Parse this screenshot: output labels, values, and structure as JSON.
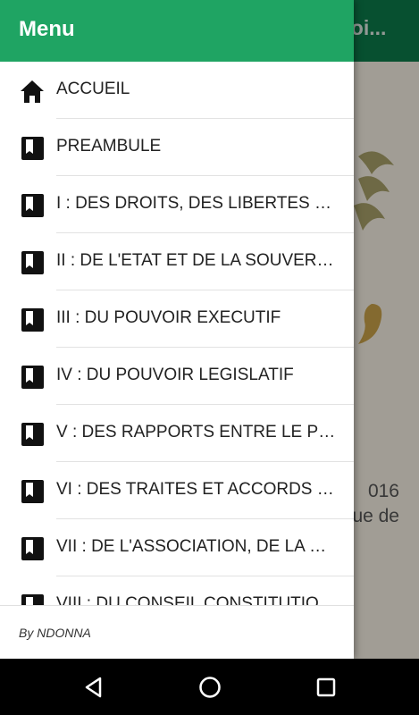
{
  "background": {
    "title": "voi...",
    "text_line1": "016",
    "text_line2": "ue de"
  },
  "drawer": {
    "title": "Menu",
    "items": [
      {
        "label": "ACCUEIL",
        "icon": "home-icon"
      },
      {
        "label": "PREAMBULE",
        "icon": "book-icon"
      },
      {
        "label": "I : DES DROITS, DES LIBERTES ET DES DEVOIRS",
        "icon": "book-icon"
      },
      {
        "label": "II : DE L'ETAT ET DE LA SOUVERAINETE",
        "icon": "book-icon"
      },
      {
        "label": "III : DU POUVOIR EXECUTIF",
        "icon": "book-icon"
      },
      {
        "label": "IV : DU POUVOIR LEGISLATIF",
        "icon": "book-icon"
      },
      {
        "label": "V : DES RAPPORTS ENTRE LE POUVOIR EXECUTIF ET LE POUVOIR LEGISLATIF",
        "icon": "book-icon"
      },
      {
        "label": "VI : DES TRAITES ET ACCORDS INTERNATIONAUX",
        "icon": "book-icon"
      },
      {
        "label": "VII : DE L'ASSOCIATION, DE LA COOPERATION",
        "icon": "book-icon"
      },
      {
        "label": "VIII : DU CONSEIL CONSTITUTIONNEL",
        "icon": "book-icon"
      }
    ],
    "footer": "By NDONNA"
  },
  "colors": {
    "header": "#1fa463",
    "appbar_behind": "#0b7a4a"
  }
}
